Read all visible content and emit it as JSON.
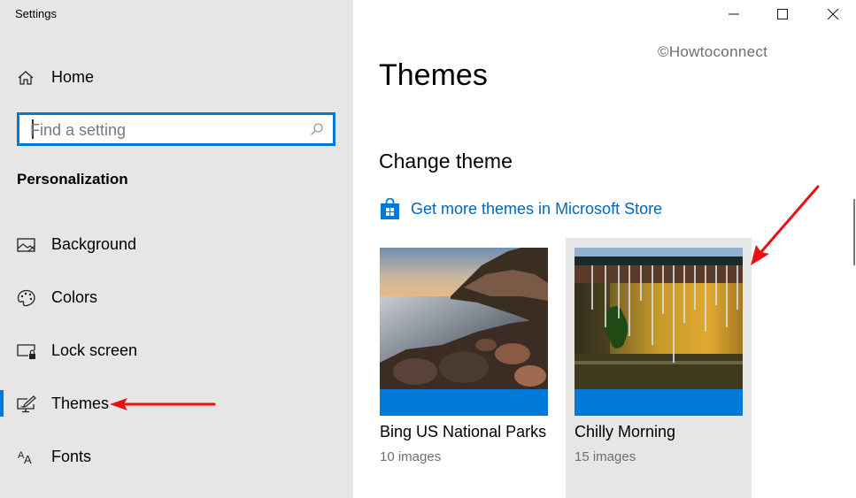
{
  "window": {
    "title": "Settings",
    "controls": {
      "minimize": "minimize",
      "maximize": "maximize",
      "close": "close"
    }
  },
  "sidebar": {
    "home_label": "Home",
    "search": {
      "placeholder": "Find a setting",
      "value": ""
    },
    "section_heading": "Personalization",
    "items": [
      {
        "label": "Background",
        "icon": "picture-icon",
        "active": false
      },
      {
        "label": "Colors",
        "icon": "palette-icon",
        "active": false
      },
      {
        "label": "Lock screen",
        "icon": "lock-screen-icon",
        "active": false
      },
      {
        "label": "Themes",
        "icon": "themes-brush-monitor-icon",
        "active": true
      },
      {
        "label": "Fonts",
        "icon": "fonts-icon",
        "active": false
      }
    ]
  },
  "main": {
    "watermark": "©Howtoconnect",
    "page_title": "Themes",
    "sub_heading": "Change theme",
    "store_link": "Get more themes in Microsoft Store",
    "themes": [
      {
        "name": "Bing US National Parks",
        "count": "10 images",
        "selected": false
      },
      {
        "name": "Chilly Morning",
        "count": "15 images",
        "selected": true
      }
    ]
  },
  "colors": {
    "accent": "#0078d7",
    "link": "#0067c0",
    "sidebar_bg": "#e6e6e6",
    "annotation": "#e81010"
  }
}
